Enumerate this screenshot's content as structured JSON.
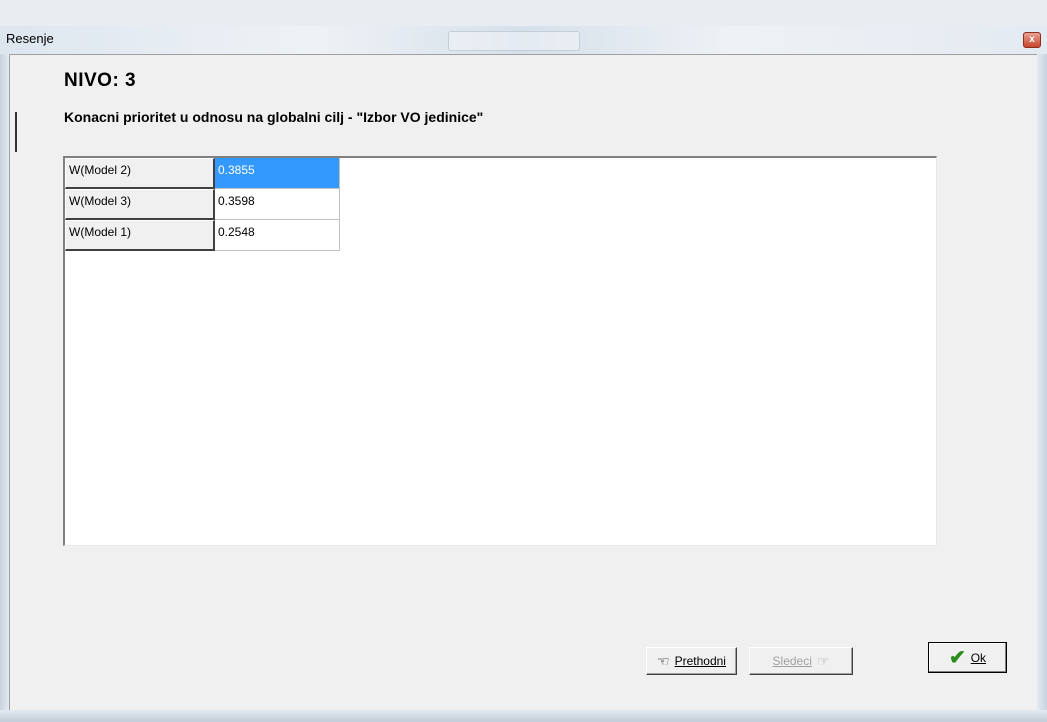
{
  "window": {
    "title": "Resenje",
    "close_symbol": "x"
  },
  "header": {
    "level": "NIVO:  3",
    "subtitle": "Konacni prioritet u odnosu na globalni cilj - \"Izbor VO jedinice\""
  },
  "table": {
    "rows": [
      {
        "label": "W(Model 2)",
        "value": "0.3855",
        "selected": true
      },
      {
        "label": "W(Model 3)",
        "value": "0.3598",
        "selected": false
      },
      {
        "label": "W(Model 1)",
        "value": "0.2548",
        "selected": false
      }
    ]
  },
  "buttons": {
    "prev": {
      "label": "Prethodni",
      "icon": "hand-left-icon",
      "enabled": true
    },
    "next": {
      "label": "Sledeci",
      "icon": "hand-right-icon",
      "enabled": false
    },
    "ok": {
      "label": "Ok",
      "icon": "checkmark-icon",
      "enabled": true
    }
  },
  "colors": {
    "selection": "#3399ff",
    "ok_check": "#2a8a1a"
  }
}
